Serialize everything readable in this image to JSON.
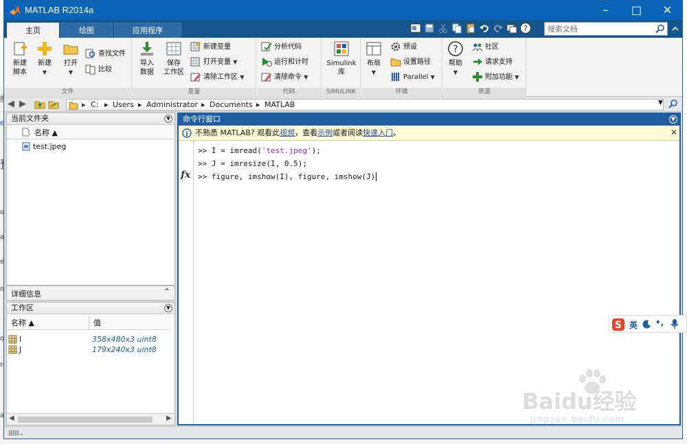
{
  "window": {
    "title": "MATLAB R2014a"
  },
  "tabs": [
    {
      "label": "主页"
    },
    {
      "label": "绘图"
    },
    {
      "label": "应用程序"
    }
  ],
  "search": {
    "placeholder": "搜索文档"
  },
  "ribbon": {
    "groups": {
      "file": "文件",
      "variable": "变量",
      "code": "代码",
      "simulink": "SIMULINK",
      "environment": "环境",
      "resources": "资源"
    },
    "new_script": [
      "新建",
      "脚本"
    ],
    "new": "新建",
    "open": "打开",
    "find_files": "查找文件",
    "compare": "比较",
    "import_data": [
      "导入",
      "数据"
    ],
    "save_workspace": [
      "保存",
      "工作区"
    ],
    "new_variable": "新建变量",
    "open_variable": "打开变量",
    "clear_workspace": "清除工作区",
    "analyze_code": "分析代码",
    "run_and_time": "运行和计时",
    "clear_commands": "清除命令",
    "simulink_library": [
      "Simulink",
      "库"
    ],
    "layout": "布局",
    "preferences": "预设",
    "set_path": "设置路径",
    "parallel": "Parallel",
    "help": "帮助",
    "community": "社区",
    "request_support": "请求支持",
    "add_ons": "附加功能"
  },
  "address": {
    "crumbs": [
      "C:",
      "Users",
      "Administrator",
      "Documents",
      "MATLAB"
    ]
  },
  "current_folder": {
    "title": "当前文件夹",
    "column_name": "名称 ▲",
    "files": [
      {
        "name": "test.jpeg"
      }
    ]
  },
  "details": {
    "title": "详细信息"
  },
  "workspace": {
    "title": "工作区",
    "col_name": "名称 ▲",
    "col_value": "值",
    "vars": [
      {
        "name": "I",
        "value": "358x480x3 uint8"
      },
      {
        "name": "J",
        "value": "179x240x3 uint8"
      }
    ]
  },
  "command_window": {
    "title": "命令行窗口",
    "info": {
      "prefix": "不熟悉 MATLAB? 观看此",
      "link_video": "视频",
      "mid1": "，查看",
      "link_examples": "示例",
      "mid2": "或者阅读",
      "link_quickstart": "快速入门",
      "suffix": "。"
    },
    "lines": [
      {
        "prompt": ">> ",
        "pre": "I = imread(",
        "str": "'test.jpeg'",
        "post": ");"
      },
      {
        "prompt": ">> ",
        "pre": "J = imresize(I, 0.5);",
        "str": "",
        "post": ""
      },
      {
        "prompt": ">> ",
        "pre": "figure, imshow(I), figure, imshow(J)",
        "str": "",
        "post": ""
      }
    ],
    "fx": "fx"
  },
  "ime": {
    "lang": "英"
  },
  "watermark": {
    "brand": "Baidu经验",
    "url": "jingyan.baidu.com"
  },
  "colors": {
    "titlebar": "#0a64b8",
    "tabstrip": "#16548e",
    "panel_accent": "#1f5ea3",
    "string_literal": "#a020f0"
  }
}
